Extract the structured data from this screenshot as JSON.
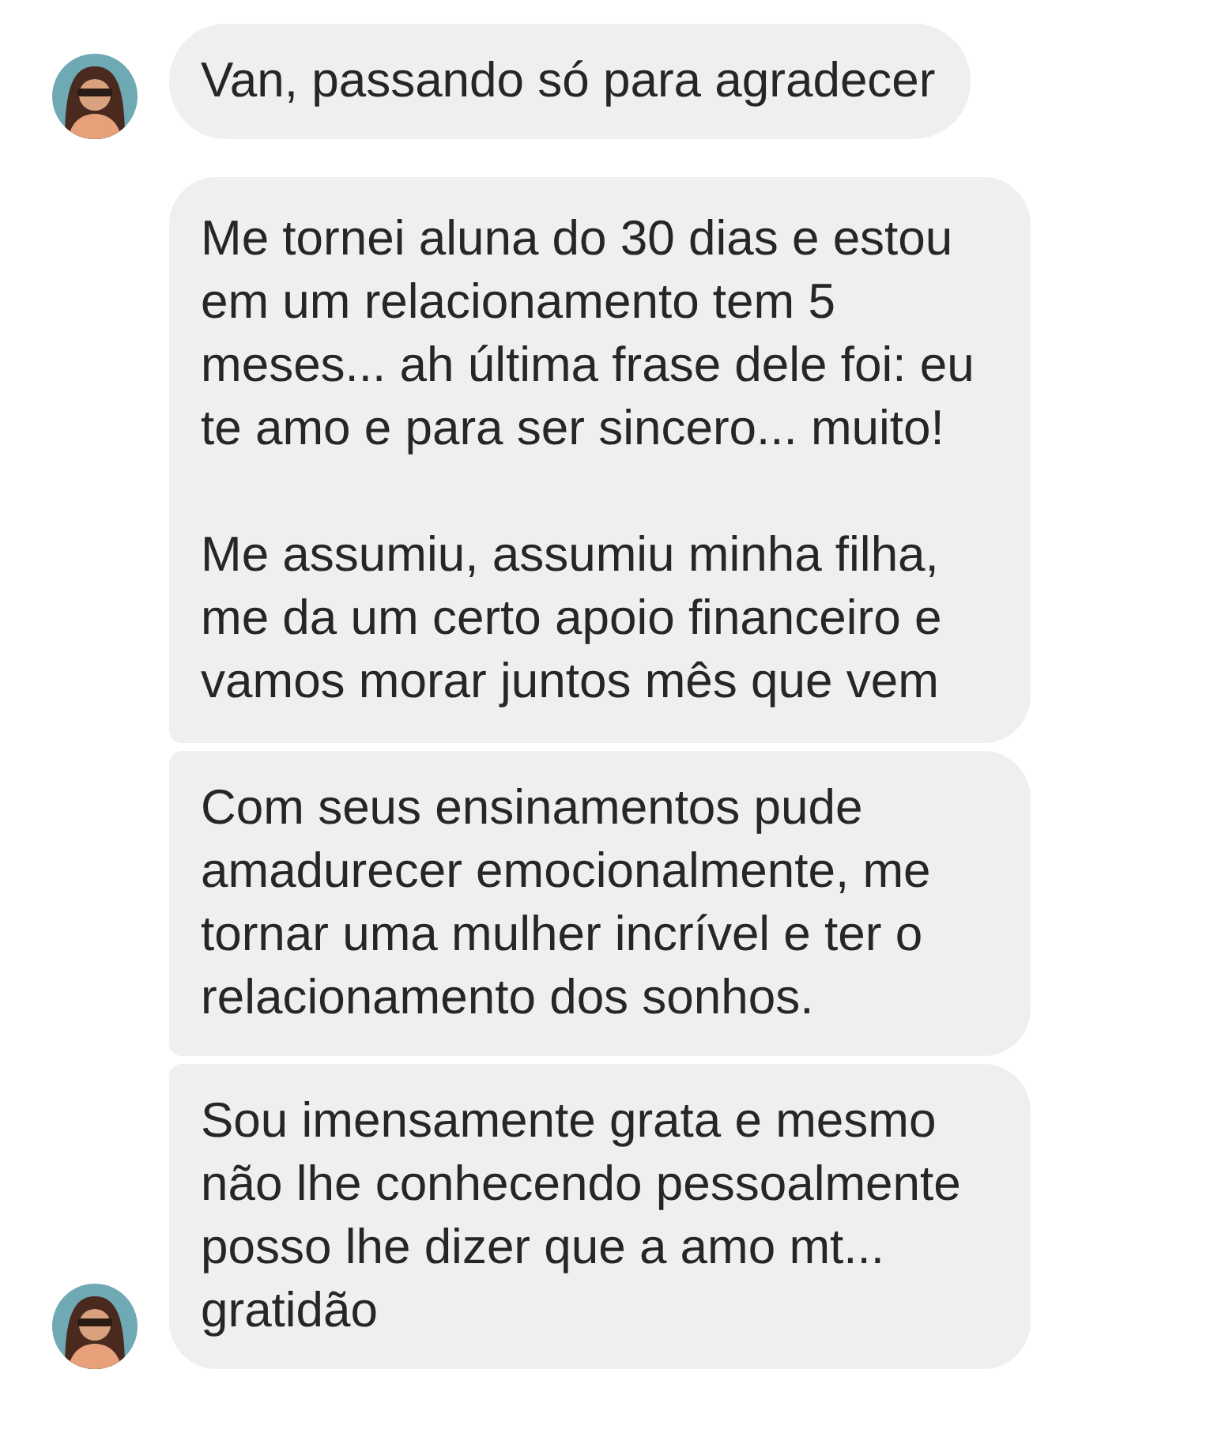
{
  "messages": [
    {
      "text": "Van, passando só para agradecer",
      "show_avatar": true
    },
    {
      "text": "Me tornei aluna do 30 dias e estou em um relacionamento tem 5 meses... ah última frase dele foi: eu te amo e para ser sincero... muito!\n\nMe assumiu, assumiu minha filha, me da um certo apoio financeiro e vamos morar juntos mês que vem",
      "show_avatar": false
    },
    {
      "text": "Com seus ensinamentos pude amadurecer emocionalmente, me tornar uma mulher incrível e ter o relacionamento dos sonhos.",
      "show_avatar": false
    },
    {
      "text": "Sou imensamente grata e mesmo não lhe conhecendo pessoalmente posso lhe dizer que a amo mt... gratidão",
      "show_avatar": true
    }
  ]
}
